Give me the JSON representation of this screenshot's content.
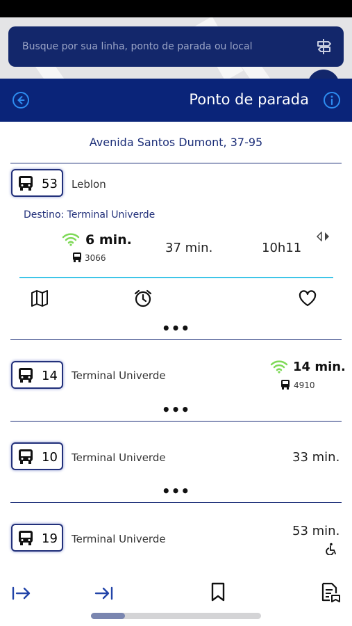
{
  "search": {
    "placeholder": "Busque por sua linha, ponto de parada ou local"
  },
  "header": {
    "title": "Ponto de parada"
  },
  "stop": {
    "address": "Avenida Santos Dumont, 37-95"
  },
  "expanded": {
    "line": "53",
    "destination": "Leblon",
    "destino_label": "Destino: Terminal Univerde",
    "realtime_time": "6 min.",
    "vehicle": "3066",
    "next_time": "37 min.",
    "scheduled_time": "10h11",
    "actions": [
      "map-icon",
      "alarm-icon",
      "heart-icon"
    ],
    "more": "•••"
  },
  "lines": [
    {
      "line": "14",
      "destination": "Terminal Univerde",
      "time": "14 min.",
      "vehicle": "4910",
      "realtime": true,
      "more": "•••"
    },
    {
      "line": "10",
      "destination": "Terminal Univerde",
      "time": "33 min.",
      "realtime": false,
      "more": "•••"
    },
    {
      "line": "19",
      "destination": "Terminal Univerde",
      "time": "53 min.",
      "realtime": false,
      "accessible": true
    }
  ],
  "bottom_nav": [
    "arrow-right-bar-icon",
    "arrow-to-end-icon",
    "bookmark-icon",
    "document-icon"
  ],
  "colors": {
    "navy": "#0a2479",
    "accent_blue": "#1e73d8",
    "wifi_green": "#7ed957",
    "divider_cyan": "#3ec5e8"
  }
}
